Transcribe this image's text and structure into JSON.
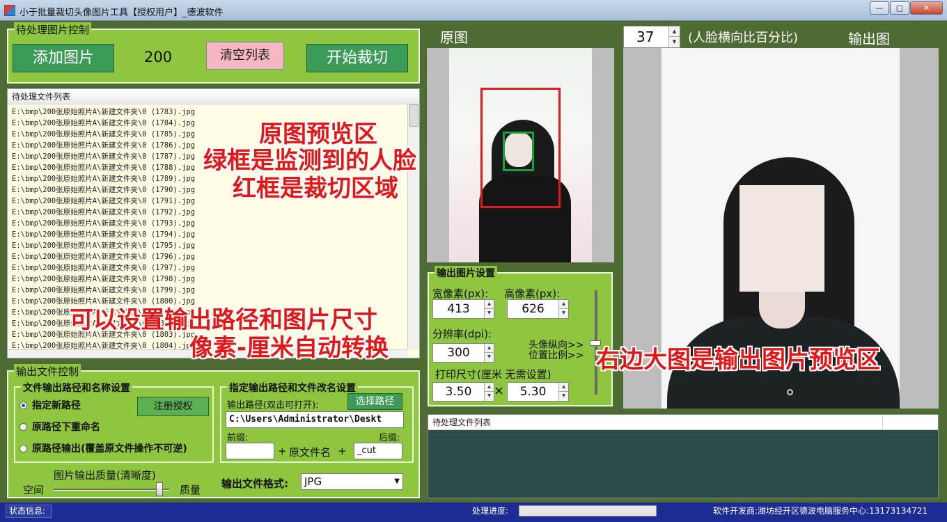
{
  "window": {
    "title": "小于批量裁切头像图片工具【授权用户】_德波软件",
    "min": "—",
    "max": "□",
    "close": "✕"
  },
  "pending_control": {
    "title": "待处理图片控制",
    "add_label": "添加图片",
    "count": "200",
    "clear_label": "清空列表",
    "start_label": "开始裁切"
  },
  "file_list": {
    "header": "待处理文件列表",
    "rows": [
      "E:\\bmp\\200张原始照片A\\新建文件夹\\0 (1783).jpg",
      "E:\\bmp\\200张原始照片A\\新建文件夹\\0 (1784).jpg",
      "E:\\bmp\\200张原始照片A\\新建文件夹\\0 (1785).jpg",
      "E:\\bmp\\200张原始照片A\\新建文件夹\\0 (1786).jpg",
      "E:\\bmp\\200张原始照片A\\新建文件夹\\0 (1787).jpg",
      "E:\\bmp\\200张原始照片A\\新建文件夹\\0 (1788).jpg",
      "E:\\bmp\\200张原始照片A\\新建文件夹\\0 (1789).jpg",
      "E:\\bmp\\200张原始照片A\\新建文件夹\\0 (1790).jpg",
      "E:\\bmp\\200张原始照片A\\新建文件夹\\0 (1791).jpg",
      "E:\\bmp\\200张原始照片A\\新建文件夹\\0 (1792).jpg",
      "E:\\bmp\\200张原始照片A\\新建文件夹\\0 (1793).jpg",
      "E:\\bmp\\200张原始照片A\\新建文件夹\\0 (1794).jpg",
      "E:\\bmp\\200张原始照片A\\新建文件夹\\0 (1795).jpg",
      "E:\\bmp\\200张原始照片A\\新建文件夹\\0 (1796).jpg",
      "E:\\bmp\\200张原始照片A\\新建文件夹\\0 (1797).jpg",
      "E:\\bmp\\200张原始照片A\\新建文件夹\\0 (1798).jpg",
      "E:\\bmp\\200张原始照片A\\新建文件夹\\0 (1799).jpg",
      "E:\\bmp\\200张原始照片A\\新建文件夹\\0 (1800).jpg",
      "E:\\bmp\\200张原始照片A\\新建文件夹\\0 (1801).jpg",
      "E:\\bmp\\200张原始照片A\\新建文件夹\\0 (1802).jpg",
      "E:\\bmp\\200张原始照片A\\新建文件夹\\0 (1803).jpg",
      "E:\\bmp\\200张原始照片A\\新建文件夹\\0 (1804).jpg"
    ]
  },
  "output_control": {
    "title": "输出文件控制",
    "path_group": {
      "title": "文件输出路径和名称设置",
      "options": [
        "指定新路径",
        "原路径下重命名",
        "原路径输出(覆盖原文件操作不可逆)"
      ],
      "selected_index": 0,
      "register_label": "注册授权"
    },
    "rename_group": {
      "title": "指定输出路径和文件改名设置",
      "path_label": "输出路径(双击可打开):",
      "choose_label": "选择路径",
      "path_value": "C:\\Users\\Administrator\\Deskt",
      "prefix_label": "前缀:",
      "suffix_label": "后缀:",
      "prefix_value": "",
      "plus1": "+",
      "orig_name": "原文件名",
      "plus2": "+",
      "suffix_value": "_cut"
    },
    "quality": {
      "title": "图片输出质量(清晰度)",
      "left": "空间",
      "right": "质量",
      "level": 0.9
    },
    "format": {
      "label": "输出文件格式:",
      "value": "JPG"
    }
  },
  "preview": {
    "orig_title": "原图",
    "face_percent": "37",
    "face_percent_label": "(人脸横向比百分比)",
    "output_title": "输出图"
  },
  "image_settings": {
    "title": "输出图片设置",
    "width_label": "宽像素(px):",
    "height_label": "高像素(px):",
    "width": "413",
    "height": "626",
    "dpi_label": "分辨率(dpi):",
    "dpi": "300",
    "position_label1": "头像纵向>>",
    "position_label2": "位置比例>>",
    "print_label": "打印尺寸(厘米 无需设置)",
    "print_w": "3.50",
    "times": "×",
    "print_h": "5.30"
  },
  "queue": {
    "header": "待处理文件列表"
  },
  "status": {
    "info_label": "状态信息:",
    "progress_label": "处理进度:",
    "progress": 0,
    "developer": "软件开发商:潍坊经开区德波电脑服务中心:13173134721"
  },
  "annotations": {
    "a1": "原图预览区",
    "a2": "绿框是监测到的人脸",
    "a3": "红框是裁切区域",
    "a4": "可以设置输出路径和图片尺寸",
    "a5": "像素-厘米自动转换",
    "a6": "右边大图是输出图片预览区"
  },
  "colors": {
    "panel_green": "#8fc63f",
    "background": "#4e6b34",
    "button_green": "#3c9b57",
    "clear_pink": "#f5b8c3",
    "status_blue": "#1d2c93",
    "annotation_red": "#e01818"
  }
}
